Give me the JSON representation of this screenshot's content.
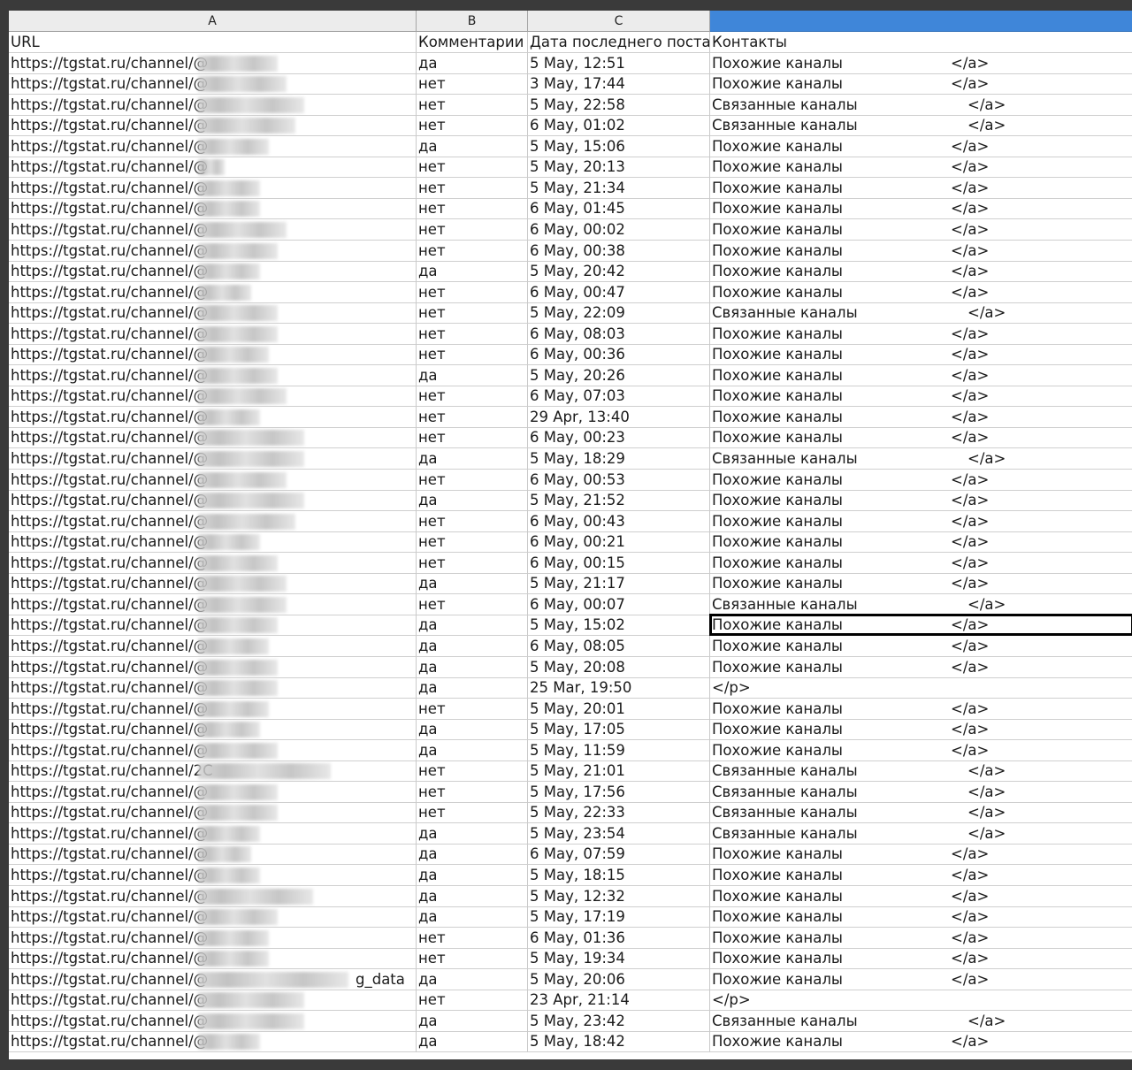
{
  "column_letters": [
    "A",
    "B",
    "C"
  ],
  "header": {
    "url": "URL",
    "comments": "Комментарии",
    "last_post": "Дата последнего поста",
    "contacts": "Контакты"
  },
  "rows": [
    {
      "url": "https://tgstat.ru/channel/@",
      "comments": "да",
      "date": "5 May, 12:51",
      "contact": "Похожие каналы",
      "tag": "</a>"
    },
    {
      "url": "https://tgstat.ru/channel/@",
      "comments": "нет",
      "date": "3 May, 17:44",
      "contact": "Похожие каналы",
      "tag": "</a>"
    },
    {
      "url": "https://tgstat.ru/channel/@",
      "comments": "нет",
      "date": "5 May, 22:58",
      "contact": "Связанные каналы",
      "tag": "</a>"
    },
    {
      "url": "https://tgstat.ru/channel/@",
      "comments": "нет",
      "date": "6 May, 01:02",
      "contact": "Связанные каналы",
      "tag": "</a>"
    },
    {
      "url": "https://tgstat.ru/channel/@",
      "comments": "да",
      "date": "5 May, 15:06",
      "contact": "Похожие каналы",
      "tag": "</a>"
    },
    {
      "url": "https://tgstat.ru/channel/@",
      "comments": "нет",
      "date": "5 May, 20:13",
      "contact": "Похожие каналы",
      "tag": "</a>"
    },
    {
      "url": "https://tgstat.ru/channel/@",
      "comments": "нет",
      "date": "5 May, 21:34",
      "contact": "Похожие каналы",
      "tag": "</a>"
    },
    {
      "url": "https://tgstat.ru/channel/@",
      "comments": "нет",
      "date": "6 May, 01:45",
      "contact": "Похожие каналы",
      "tag": "</a>"
    },
    {
      "url": "https://tgstat.ru/channel/@",
      "comments": "нет",
      "date": "6 May, 00:02",
      "contact": "Похожие каналы",
      "tag": "</a>"
    },
    {
      "url": "https://tgstat.ru/channel/@",
      "comments": "нет",
      "date": "6 May, 00:38",
      "contact": "Похожие каналы",
      "tag": "</a>"
    },
    {
      "url": "https://tgstat.ru/channel/@",
      "comments": "да",
      "date": "5 May, 20:42",
      "contact": "Похожие каналы",
      "tag": "</a>"
    },
    {
      "url": "https://tgstat.ru/channel/@",
      "comments": "нет",
      "date": "6 May, 00:47",
      "contact": "Похожие каналы",
      "tag": "</a>"
    },
    {
      "url": "https://tgstat.ru/channel/@",
      "comments": "нет",
      "date": "5 May, 22:09",
      "contact": "Связанные каналы",
      "tag": "</a>"
    },
    {
      "url": "https://tgstat.ru/channel/@",
      "comments": "нет",
      "date": "6 May, 08:03",
      "contact": "Похожие каналы",
      "tag": "</a>"
    },
    {
      "url": "https://tgstat.ru/channel/@",
      "comments": "нет",
      "date": "6 May, 00:36",
      "contact": "Похожие каналы",
      "tag": "</a>"
    },
    {
      "url": "https://tgstat.ru/channel/@",
      "comments": "да",
      "date": "5 May, 20:26",
      "contact": "Похожие каналы",
      "tag": "</a>"
    },
    {
      "url": "https://tgstat.ru/channel/@",
      "comments": "нет",
      "date": "6 May, 07:03",
      "contact": "Похожие каналы",
      "tag": "</a>"
    },
    {
      "url": "https://tgstat.ru/channel/@",
      "comments": "нет",
      "date": "29 Apr, 13:40",
      "contact": "Похожие каналы",
      "tag": "</a>"
    },
    {
      "url": "https://tgstat.ru/channel/@",
      "comments": "нет",
      "date": "6 May, 00:23",
      "contact": "Похожие каналы",
      "tag": "</a>"
    },
    {
      "url": "https://tgstat.ru/channel/@",
      "comments": "да",
      "date": "5 May, 18:29",
      "contact": "Связанные каналы",
      "tag": "</a>"
    },
    {
      "url": "https://tgstat.ru/channel/@",
      "comments": "нет",
      "date": "6 May, 00:53",
      "contact": "Похожие каналы",
      "tag": "</a>"
    },
    {
      "url": "https://tgstat.ru/channel/@",
      "comments": "да",
      "date": "5 May, 21:52",
      "contact": "Похожие каналы",
      "tag": "</a>"
    },
    {
      "url": "https://tgstat.ru/channel/@",
      "comments": "нет",
      "date": "6 May, 00:43",
      "contact": "Похожие каналы",
      "tag": "</a>"
    },
    {
      "url": "https://tgstat.ru/channel/@",
      "comments": "нет",
      "date": "6 May, 00:21",
      "contact": "Похожие каналы",
      "tag": "</a>"
    },
    {
      "url": "https://tgstat.ru/channel/@",
      "comments": "нет",
      "date": "6 May, 00:15",
      "contact": "Похожие каналы",
      "tag": "</a>"
    },
    {
      "url": "https://tgstat.ru/channel/@",
      "comments": "да",
      "date": "5 May, 21:17",
      "contact": "Похожие каналы",
      "tag": "</a>"
    },
    {
      "url": "https://tgstat.ru/channel/@",
      "comments": "нет",
      "date": "6 May, 00:07",
      "contact": "Связанные каналы",
      "tag": "</a>"
    },
    {
      "url": "https://tgstat.ru/channel/@",
      "comments": "да",
      "date": "5 May, 15:02",
      "contact": "Похожие каналы",
      "tag": "</a>",
      "active": true
    },
    {
      "url": "https://tgstat.ru/channel/@",
      "comments": "да",
      "date": "6 May, 08:05",
      "contact": "Похожие каналы",
      "tag": "</a>"
    },
    {
      "url": "https://tgstat.ru/channel/@",
      "comments": "да",
      "date": "5 May, 20:08",
      "contact": "Похожие каналы",
      "tag": "</a>"
    },
    {
      "url": "https://tgstat.ru/channel/@",
      "comments": "да",
      "date": "25 Mar, 19:50",
      "contact": "</p>",
      "tag": ""
    },
    {
      "url": "https://tgstat.ru/channel/@",
      "comments": "нет",
      "date": "5 May, 20:01",
      "contact": "Похожие каналы",
      "tag": "</a>"
    },
    {
      "url": "https://tgstat.ru/channel/@",
      "comments": "да",
      "date": "5 May, 17:05",
      "contact": "Похожие каналы",
      "tag": "</a>"
    },
    {
      "url": "https://tgstat.ru/channel/@",
      "comments": "да",
      "date": "5 May, 11:59",
      "contact": "Похожие каналы",
      "tag": "</a>"
    },
    {
      "url": "https://tgstat.ru/channel/2C",
      "comments": "нет",
      "date": "5 May, 21:01",
      "contact": "Связанные каналы",
      "tag": "</a>"
    },
    {
      "url": "https://tgstat.ru/channel/@",
      "comments": "нет",
      "date": "5 May, 17:56",
      "contact": "Связанные каналы",
      "tag": "</a>"
    },
    {
      "url": "https://tgstat.ru/channel/@",
      "comments": "нет",
      "date": "5 May, 22:33",
      "contact": "Связанные каналы",
      "tag": "</a>"
    },
    {
      "url": "https://tgstat.ru/channel/@",
      "comments": "да",
      "date": "5 May, 23:54",
      "contact": "Связанные каналы",
      "tag": "</a>"
    },
    {
      "url": "https://tgstat.ru/channel/@",
      "comments": "да",
      "date": "6 May, 07:59",
      "contact": "Похожие каналы",
      "tag": "</a>"
    },
    {
      "url": "https://tgstat.ru/channel/@",
      "comments": "да",
      "date": "5 May, 18:15",
      "contact": "Похожие каналы",
      "tag": "</a>"
    },
    {
      "url": "https://tgstat.ru/channel/@",
      "comments": "да",
      "date": "5 May, 12:32",
      "contact": "Похожие каналы",
      "tag": "</a>"
    },
    {
      "url": "https://tgstat.ru/channel/@",
      "comments": "да",
      "date": "5 May, 17:19",
      "contact": "Похожие каналы",
      "tag": "</a>"
    },
    {
      "url": "https://tgstat.ru/channel/@",
      "comments": "нет",
      "date": "6 May, 01:36",
      "contact": "Похожие каналы",
      "tag": "</a>"
    },
    {
      "url": "https://tgstat.ru/channel/@",
      "comments": "нет",
      "date": "5 May, 19:34",
      "contact": "Похожие каналы",
      "tag": "</a>"
    },
    {
      "url": "https://tgstat.ru/channel/@",
      "suffix": "g_data",
      "comments": "да",
      "date": "5 May, 20:06",
      "contact": "Похожие каналы",
      "tag": "</a>"
    },
    {
      "url": "https://tgstat.ru/channel/@",
      "comments": "нет",
      "date": "23 Apr, 21:14",
      "contact": "</p>",
      "tag": ""
    },
    {
      "url": "https://tgstat.ru/channel/@",
      "comments": "да",
      "date": "5 May, 23:42",
      "contact": "Связанные каналы",
      "tag": "</a>"
    },
    {
      "url": "https://tgstat.ru/channel/@",
      "comments": "да",
      "date": "5 May, 18:42",
      "contact": "Похожие каналы",
      "tag": "</a>"
    }
  ]
}
